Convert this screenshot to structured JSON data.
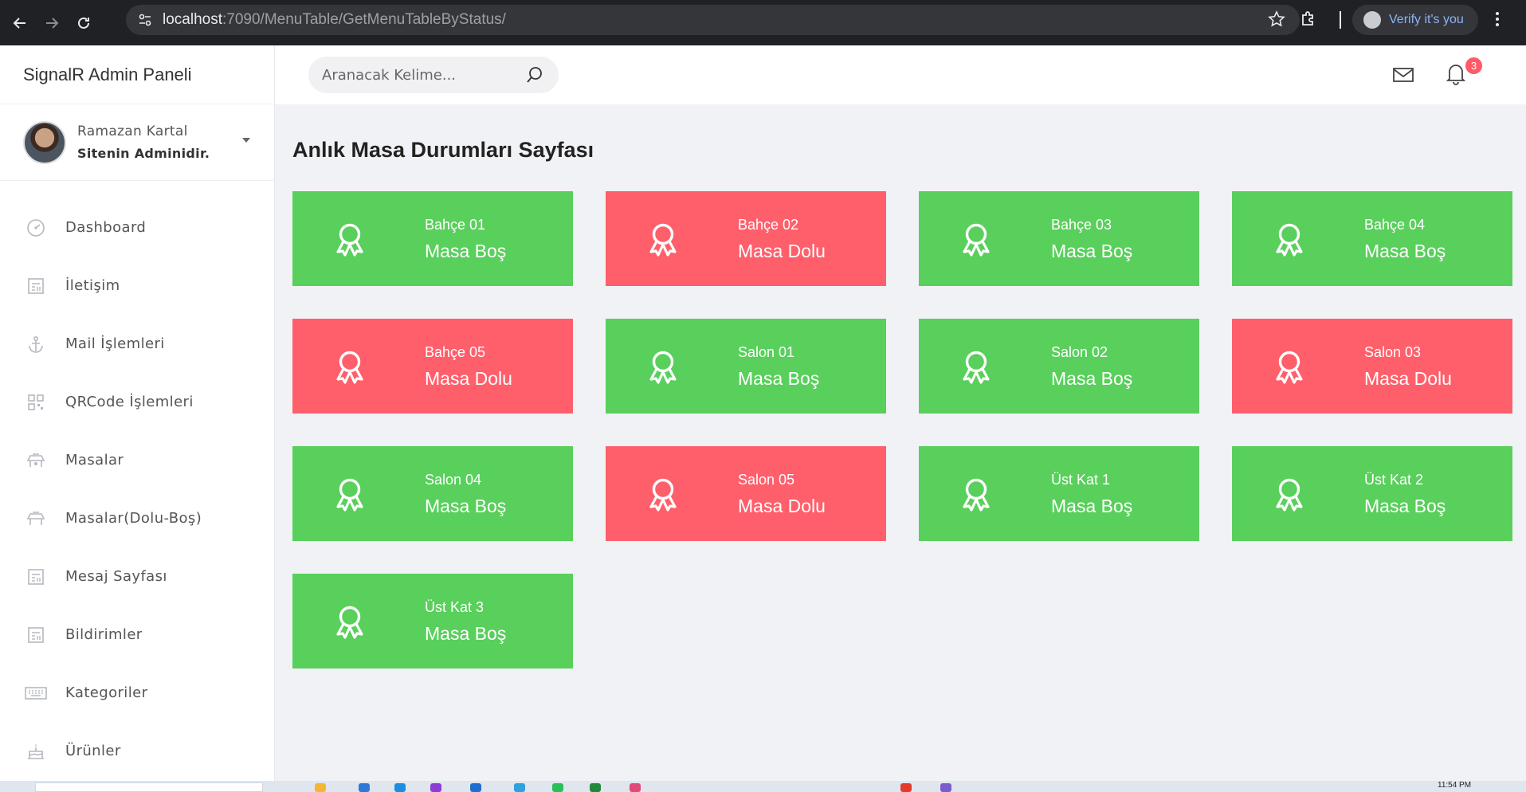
{
  "browser": {
    "url_host": "localhost",
    "url_path": ":7090/MenuTable/GetMenuTableByStatus/",
    "profile_label": "Verify it's you"
  },
  "sidebar": {
    "brand": "SignalR Admin Paneli",
    "user": {
      "name": "Ramazan Kartal",
      "role": "Sitenin Adminidir."
    },
    "items": [
      {
        "label": "Dashboard",
        "icon": "dashboard-icon"
      },
      {
        "label": "İletişim",
        "icon": "form-icon"
      },
      {
        "label": "Mail İşlemleri",
        "icon": "anchor-icon"
      },
      {
        "label": "QRCode İşlemleri",
        "icon": "qrcode-icon"
      },
      {
        "label": "Masalar",
        "icon": "table-icon"
      },
      {
        "label": "Masalar(Dolu-Boş)",
        "icon": "table-icon"
      },
      {
        "label": "Mesaj Sayfası",
        "icon": "form-icon"
      },
      {
        "label": "Bildirimler",
        "icon": "form-icon"
      },
      {
        "label": "Kategoriler",
        "icon": "keyboard-icon"
      },
      {
        "label": "Ürünler",
        "icon": "cake-icon"
      }
    ]
  },
  "topbar": {
    "search_placeholder": "Aranacak Kelime...",
    "notification_count": "3"
  },
  "main": {
    "title": "Anlık Masa Durumları Sayfası",
    "tables": [
      {
        "name": "Bahçe 01",
        "status": "Masa Boş",
        "state": "bos"
      },
      {
        "name": "Bahçe 02",
        "status": "Masa Dolu",
        "state": "dolu"
      },
      {
        "name": "Bahçe 03",
        "status": "Masa Boş",
        "state": "bos"
      },
      {
        "name": "Bahçe 04",
        "status": "Masa Boş",
        "state": "bos"
      },
      {
        "name": "Bahçe 05",
        "status": "Masa Dolu",
        "state": "dolu"
      },
      {
        "name": "Salon 01",
        "status": "Masa Boş",
        "state": "bos"
      },
      {
        "name": "Salon 02",
        "status": "Masa Boş",
        "state": "bos"
      },
      {
        "name": "Salon 03",
        "status": "Masa Dolu",
        "state": "dolu"
      },
      {
        "name": "Salon 04",
        "status": "Masa Boş",
        "state": "bos"
      },
      {
        "name": "Salon 05",
        "status": "Masa Dolu",
        "state": "dolu"
      },
      {
        "name": "Üst Kat 1",
        "status": "Masa Boş",
        "state": "bos"
      },
      {
        "name": "Üst Kat 2",
        "status": "Masa Boş",
        "state": "bos"
      },
      {
        "name": "Üst Kat 3",
        "status": "Masa Boş",
        "state": "bos"
      }
    ]
  },
  "colors": {
    "empty": "#59cf5c",
    "full": "#ff5f6b",
    "badge": "#ff5a67"
  },
  "taskbar": {
    "clock": "11:54 PM"
  }
}
